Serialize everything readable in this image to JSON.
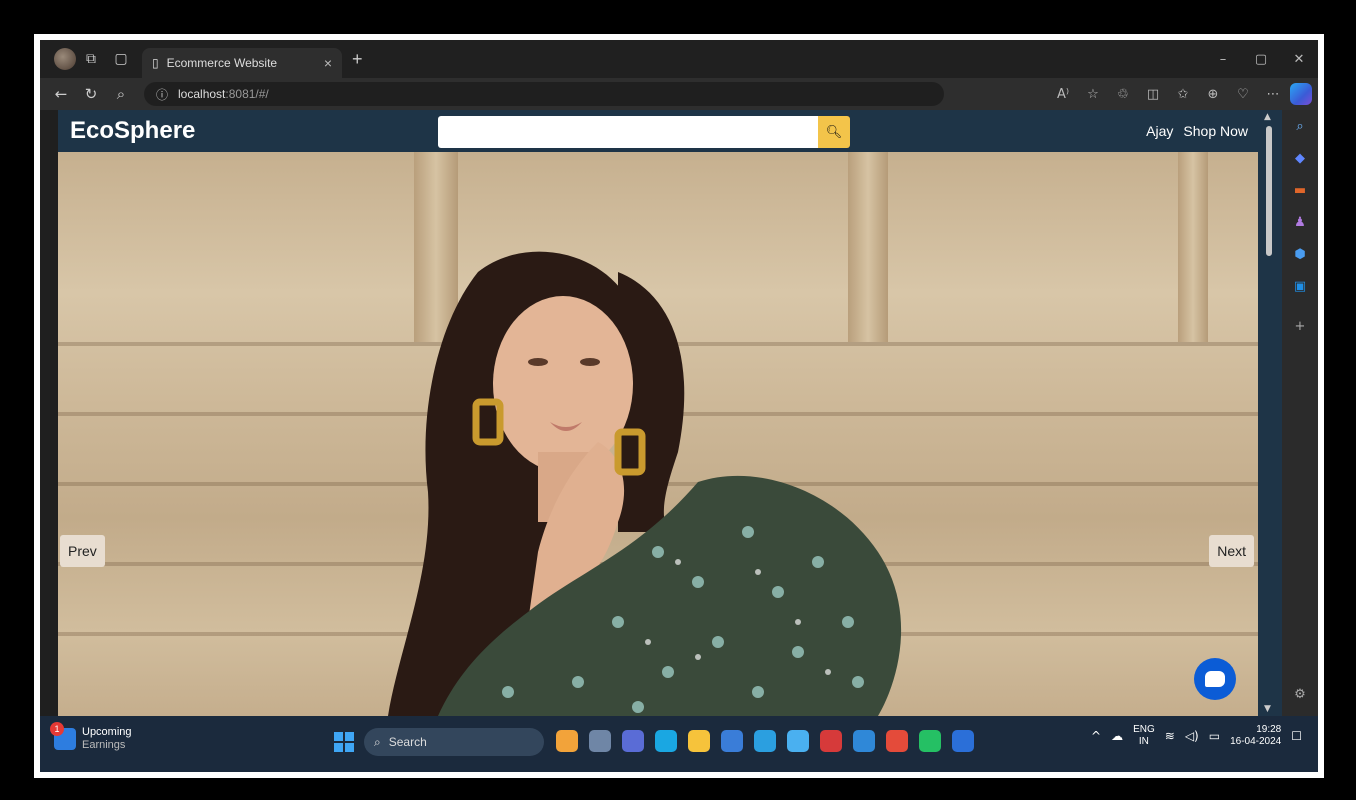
{
  "browser": {
    "tab_title": "Ecommerce Website",
    "tab_close": "×",
    "new_tab": "+",
    "url_host": "localhost",
    "url_rest": ":8081/#/",
    "window_controls": [
      "–",
      "▢",
      "✕"
    ],
    "address_icons": [
      "A⁾",
      "☆",
      "♲",
      "◫",
      "✩",
      "⊕",
      "♡",
      "⋯"
    ]
  },
  "page": {
    "logo": "EcoSphere",
    "search": {
      "placeholder": "",
      "button_icon": "search-icon"
    },
    "nav_links": {
      "user": "Ajay",
      "shop": "Shop Now"
    },
    "carousel": {
      "prev": "Prev",
      "next": "Next"
    }
  },
  "taskbar": {
    "weather_badge": "1",
    "weather_title": "Upcoming",
    "weather_sub": "Earnings",
    "search_label": "Search",
    "lang_top": "ENG",
    "lang_bottom": "IN",
    "time": "19:28",
    "date": "16-04-2024",
    "app_colors": [
      "#f2a33a",
      "#6f86a6",
      "#5a6cd6",
      "#1aa7e2",
      "#f6c33b",
      "#3a7dd8",
      "#2b9fe0",
      "#4ab0f0",
      "#d63a3a",
      "#2f88d8",
      "#e44b3a",
      "#25c064",
      "#2b6fd8"
    ]
  },
  "colors": {
    "navbar_bg": "#1e3447",
    "search_button": "#f3c44a",
    "chat_button": "#0b5cd6"
  }
}
